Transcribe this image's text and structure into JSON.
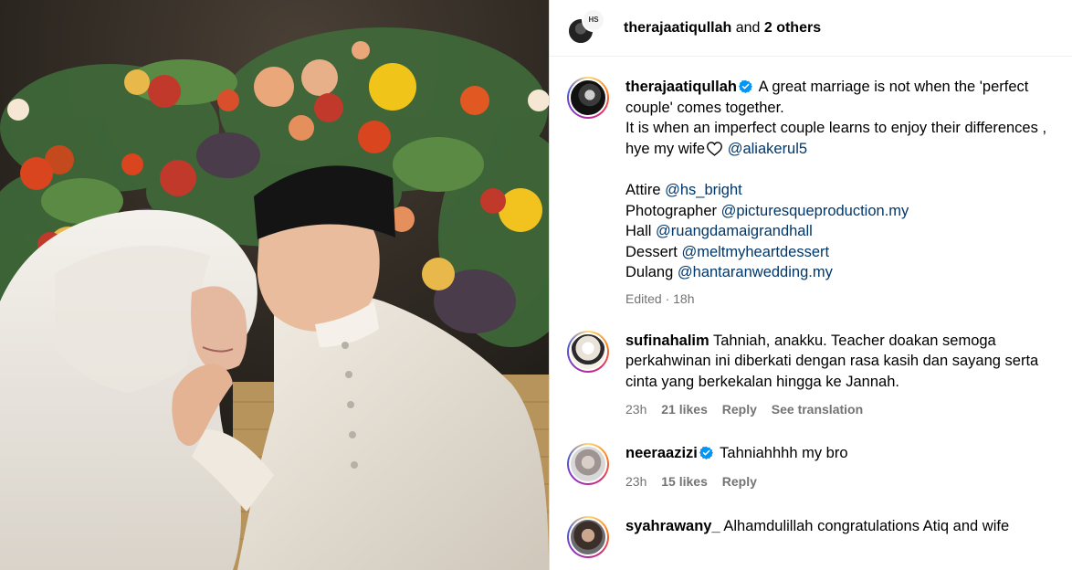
{
  "header": {
    "author": "therajaatiqullah",
    "joiner": "and",
    "others": "2 others"
  },
  "post": {
    "username": "therajaatiqullah",
    "caption_line1": "A great marriage is not when the 'perfect couple' comes together.",
    "caption_line2": "It is when an imperfect couple learns to enjoy their differences ,",
    "caption_line3_prefix": "hye my wife",
    "caption_line3_mention": "@aliakerul5",
    "credits": [
      {
        "label": "Attire",
        "mention": "@hs_bright"
      },
      {
        "label": "Photographer",
        "mention": "@picturesqueproduction.my"
      },
      {
        "label": "Hall",
        "mention": "@ruangdamaigrandhall"
      },
      {
        "label": "Dessert",
        "mention": "@meltmyheartdessert"
      },
      {
        "label": "Dulang",
        "mention": "@hantaranwedding.my"
      }
    ],
    "meta": "Edited · 18h"
  },
  "comments": [
    {
      "username": "sufinahalim",
      "verified": false,
      "text": "Tahniah, anakku. Teacher doakan semoga perkahwinan ini diberkati dengan rasa kasih dan sayang serta cinta yang berkekalan hingga ke Jannah.",
      "time": "23h",
      "likes": "21 likes",
      "reply": "Reply",
      "translate": "See translation"
    },
    {
      "username": "neeraazizi",
      "verified": true,
      "text": "Tahniahhhh my bro",
      "time": "23h",
      "likes": "15 likes",
      "reply": "Reply"
    },
    {
      "username": "syahrawany_",
      "verified": false,
      "text": "Alhamdulillah congratulations Atiq and wife"
    }
  ],
  "colors": {
    "mention": "#00376b",
    "meta": "#737373",
    "verified": "#0095f6"
  },
  "icons": [
    "verified-badge-icon",
    "heart-outline-icon"
  ]
}
